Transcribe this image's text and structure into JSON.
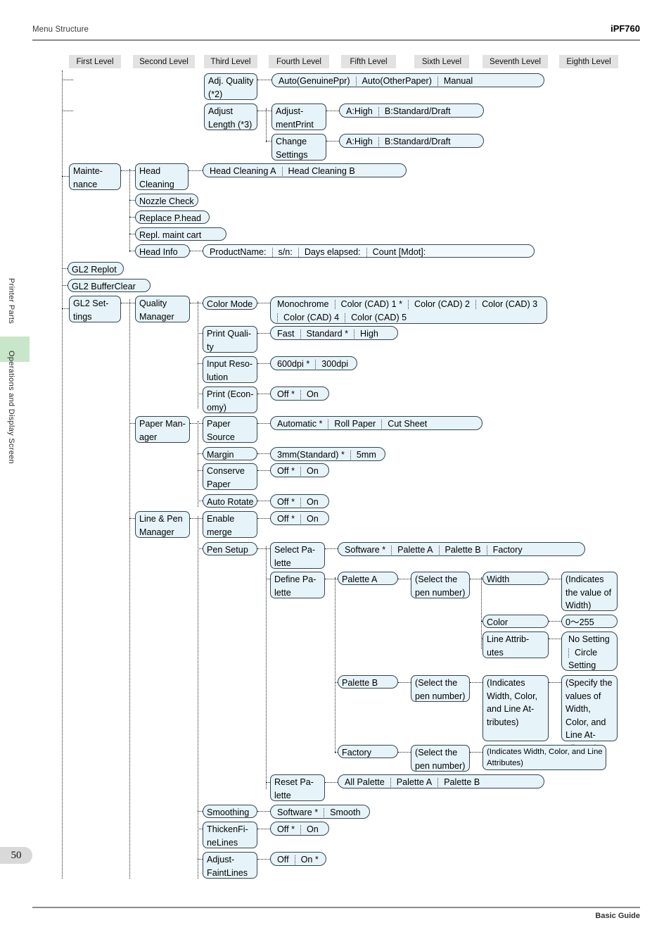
{
  "running_head": {
    "left": "Menu Structure",
    "right": "iPF760"
  },
  "sidebar": {
    "tab1": "Printer Parts",
    "tab2": "Operations and Display Screen",
    "highlight_color": "#c8e6c9"
  },
  "footer": {
    "page_number": "50",
    "guide": "Basic Guide"
  },
  "column_headers": [
    "First Level",
    "Second Level",
    "Third Level",
    "Fourth Level",
    "Fifth Level",
    "Sixth Level",
    "Seventh Level",
    "Eighth Level"
  ],
  "nodes": {
    "adj_quality": "Adj. Quality (*2)",
    "adj_quality_opts": [
      "Auto(GenuinePpr)",
      "Auto(OtherPaper)",
      "Manual"
    ],
    "adjust_length": "Adjust Length (*3)",
    "adjustment_print": "Adjust-\nmentPrint",
    "adjustment_print_opts": [
      "A:High",
      "B:Standard/Draft"
    ],
    "change_settings": "Change Settings",
    "change_settings_opts": [
      "A:High",
      "B:Standard/Draft"
    ],
    "maintenance": "Mainte-\nnance",
    "head_cleaning": "Head Cleaning",
    "head_cleaning_opts": [
      "Head Cleaning A",
      "Head Cleaning B"
    ],
    "nozzle_check": "Nozzle Check",
    "replace_phead": "Replace P.head",
    "repl_maint_cart": "Repl. maint cart",
    "head_info": "Head Info",
    "head_info_opts": [
      "ProductName:",
      "s/n:",
      "Days elapsed:",
      "Count [Mdot]:"
    ],
    "gl2_replot": "GL2 Replot",
    "gl2_bufferclear": "GL2 BufferClear",
    "gl2_settings": "GL2 Set-\ntings",
    "quality_manager": "Quality Manager",
    "color_mode": "Color Mode",
    "color_mode_opts": [
      "Monochrome",
      "Color (CAD) 1 *",
      "Color (CAD) 2",
      "Color (CAD) 3",
      "Color (CAD) 4",
      "Color (CAD) 5"
    ],
    "print_quality": "Print Quali-\nty",
    "print_quality_opts": [
      "Fast",
      "Standard *",
      "High"
    ],
    "input_resolution": "Input Reso-\nlution",
    "input_resolution_opts": [
      "600dpi *",
      "300dpi"
    ],
    "print_economy": "Print (Econ-\nomy)",
    "print_economy_opts": [
      "Off *",
      "On"
    ],
    "paper_manager": "Paper Man-\nager",
    "paper_source": "Paper Source",
    "paper_source_opts": [
      "Automatic *",
      "Roll Paper",
      "Cut Sheet"
    ],
    "margin": "Margin",
    "margin_opts": [
      "3mm(Standard) *",
      "5mm"
    ],
    "conserve_paper": "Conserve Paper",
    "conserve_paper_opts": [
      "Off *",
      "On"
    ],
    "auto_rotate": "Auto Rotate",
    "auto_rotate_opts": [
      "Off *",
      "On"
    ],
    "line_pen_manager": "Line & Pen Manager",
    "enable_merge": "Enable merge",
    "enable_merge_opts": [
      "Off *",
      "On"
    ],
    "pen_setup": "Pen Setup",
    "select_palette": "Select Pa-\nlette",
    "select_palette_opts": [
      "Software *",
      "Palette A",
      "Palette B",
      "Factory"
    ],
    "define_palette": "Define Pa-\nlette",
    "palette_a": "Palette A",
    "palette_a_pen": "(Select the pen number)",
    "width": "Width",
    "width_value": "(Indicates the value of Width)",
    "color": "Color",
    "color_value": "0〜255",
    "line_attributes": "Line Attrib-\nutes",
    "line_attributes_opts": [
      "No Setting",
      "Circle",
      "Setting"
    ],
    "palette_b": "Palette B",
    "palette_b_pen": "(Select the pen number)",
    "palette_b_indicates": "(Indicates Width, Color, and Line At-\ntributes)",
    "palette_b_specify": "(Specify the values of Width, Color, and Line At-\ntributes)",
    "factory": "Factory",
    "factory_pen": "(Select the pen number)",
    "factory_indicates": "(Indicates Width, Color, and Line Attributes)",
    "reset_palette": "Reset Pa-\nlette",
    "reset_palette_opts": [
      "All Palette",
      "Palette A",
      "Palette B"
    ],
    "smoothing": "Smoothing",
    "smoothing_opts": [
      "Software *",
      "Smooth"
    ],
    "thicken_fine_lines": "ThickenFi-\nneLines",
    "thicken_fine_lines_opts": [
      "Off *",
      "On"
    ],
    "adjust_faint_lines": "Adjust-\nFaintLines",
    "adjust_faint_lines_opts": [
      "Off",
      "On *"
    ]
  }
}
